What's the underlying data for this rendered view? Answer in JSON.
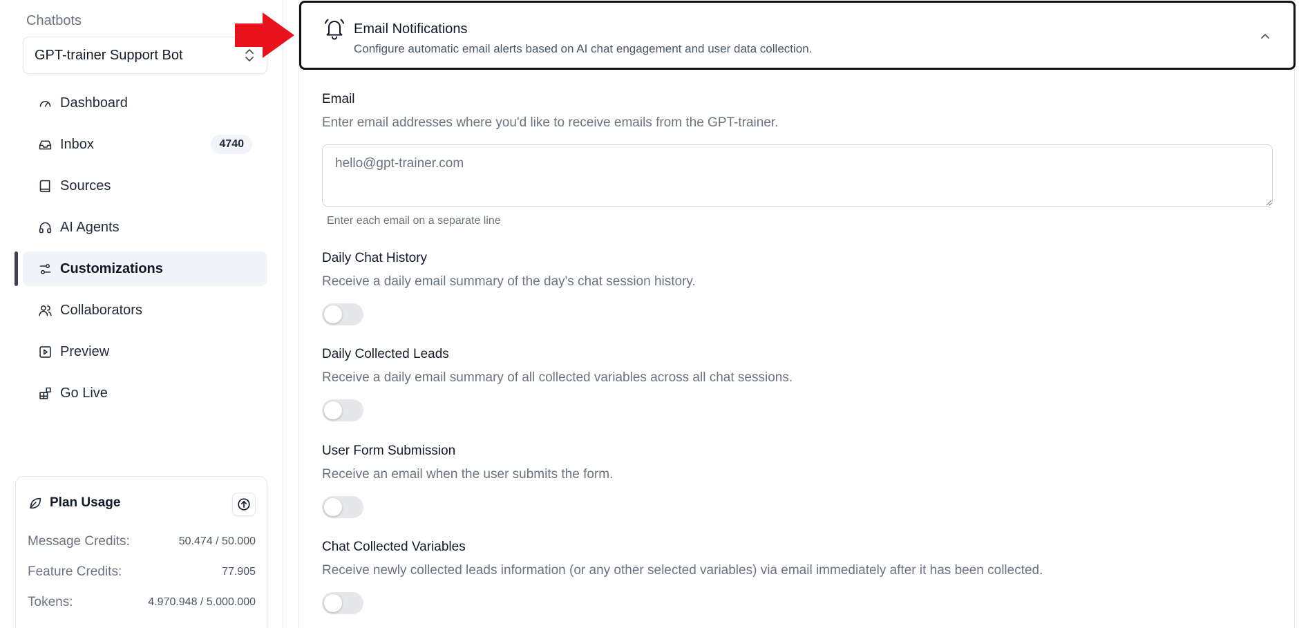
{
  "sidebar": {
    "section_label": "Chatbots",
    "bot_selector": {
      "value": "GPT-trainer Support Bot",
      "icon": "chevrons-up-down-icon"
    },
    "items": [
      {
        "label": "Dashboard",
        "icon": "gauge-icon",
        "badge": null,
        "active": false
      },
      {
        "label": "Inbox",
        "icon": "inbox-icon",
        "badge": "4740",
        "active": false
      },
      {
        "label": "Sources",
        "icon": "book-icon",
        "badge": null,
        "active": false
      },
      {
        "label": "AI Agents",
        "icon": "headphones-icon",
        "badge": null,
        "active": true
      },
      {
        "label": "Customizations",
        "icon": "sliders-icon",
        "badge": null,
        "active": true
      },
      {
        "label": "Collaborators",
        "icon": "users-icon",
        "badge": null,
        "active": false
      },
      {
        "label": "Preview",
        "icon": "play-square-icon",
        "badge": null,
        "active": false
      },
      {
        "label": "Go Live",
        "icon": "blocks-icon",
        "badge": null,
        "active": false
      }
    ],
    "active_item": "Customizations",
    "plan_usage": {
      "title": "Plan Usage",
      "icon": "leaf-icon",
      "upgrade_icon": "arrow-up-circle-icon",
      "rows": [
        {
          "label": "Message Credits:",
          "value": "50.474 / 50.000"
        },
        {
          "label": "Feature Credits:",
          "value": "77.905"
        },
        {
          "label": "Tokens:",
          "value": "4.970.948 / 5.000.000"
        }
      ]
    }
  },
  "main": {
    "section": {
      "title": "Email Notifications",
      "subtitle": "Configure automatic email alerts based on AI chat engagement and user data collection.",
      "icon": "bell-icon",
      "expanded": true
    },
    "email": {
      "title": "Email",
      "description": "Enter email addresses where you'd like to receive emails from the GPT-trainer.",
      "placeholder": "hello@gpt-trainer.com",
      "hint": "Enter each email on a separate line"
    },
    "toggles": [
      {
        "title": "Daily Chat History",
        "description": "Receive a daily email summary of the day's chat session history.",
        "enabled": false
      },
      {
        "title": "Daily Collected Leads",
        "description": "Receive a daily email summary of all collected variables across all chat sessions.",
        "enabled": false
      },
      {
        "title": "User Form Submission",
        "description": "Receive an email when the user submits the form.",
        "enabled": false
      },
      {
        "title": "Chat Collected Variables",
        "description": "Receive newly collected leads information (or any other selected variables) via email immediately after it has been collected.",
        "enabled": false
      }
    ]
  },
  "colors": {
    "annotation_arrow": "#e8121c",
    "active_indicator": "#3f3f5a",
    "toggle_off": "#e5e7eb"
  }
}
